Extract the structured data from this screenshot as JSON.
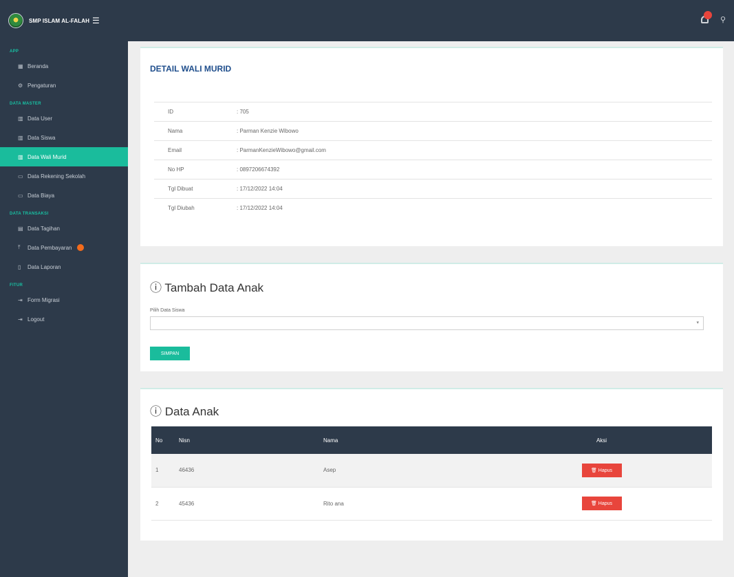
{
  "header": {
    "app_title": "SMP ISLAM AL-FALAH",
    "menu_toggle": "☰"
  },
  "sidebar": {
    "sections": [
      {
        "label": "APP",
        "items": [
          {
            "label": "Beranda",
            "icon": "grid-icon",
            "glyph": "▦"
          },
          {
            "label": "Pengaturan",
            "icon": "gear-icon",
            "glyph": "⚙"
          }
        ]
      },
      {
        "label": "DATA MASTER",
        "items": [
          {
            "label": "Data User",
            "icon": "users-icon",
            "glyph": "▥"
          },
          {
            "label": "Data Siswa",
            "icon": "users-icon",
            "glyph": "▥"
          },
          {
            "label": "Data Wali Murid",
            "icon": "users-icon",
            "glyph": "▥",
            "active": true
          },
          {
            "label": "Data Rekening Sekolah",
            "icon": "card-icon",
            "glyph": "▭"
          },
          {
            "label": "Data Biaya",
            "icon": "card-icon",
            "glyph": "▭"
          }
        ]
      },
      {
        "label": "DATA TRANSAKSI",
        "items": [
          {
            "label": "Data Tagihan",
            "icon": "calendar-icon",
            "glyph": "▤"
          },
          {
            "label": "Data Pembayaran",
            "icon": "upload-icon",
            "glyph": "⤒",
            "badge": true
          },
          {
            "label": "Data Laporan",
            "icon": "document-icon",
            "glyph": "▯"
          }
        ]
      },
      {
        "label": "FITUR",
        "items": [
          {
            "label": "Form Migrasi",
            "icon": "sign-in-icon",
            "glyph": "⇥"
          },
          {
            "label": "Logout",
            "icon": "sign-out-icon",
            "glyph": "⇥"
          }
        ]
      }
    ]
  },
  "detail": {
    "title": "DETAIL WALI MURID",
    "rows": [
      {
        "key": "ID",
        "value": ": 705"
      },
      {
        "key": "Nama",
        "value": ": Parman Kenzie Wibowo"
      },
      {
        "key": "Email",
        "value": ": ParmanKenzieWibowo@gmail.com"
      },
      {
        "key": "No HP",
        "value": ": 0897206674392"
      },
      {
        "key": "Tgl Dibuat",
        "value": ": 17/12/2022 14:04"
      },
      {
        "key": "Tgl Diubah",
        "value": ": 17/12/2022 14:04"
      }
    ]
  },
  "add_child": {
    "title": "ⓘ Tambah Data Anak",
    "select_label": "Pilih Data Siswa",
    "select_value": "",
    "save_label": "SIMPAN"
  },
  "children": {
    "title": "ⓘ Data Anak",
    "columns": [
      "No",
      "Nisn",
      "Nama",
      "Aksi"
    ],
    "rows": [
      {
        "no": "1",
        "nisn": "46436",
        "nama": "Asep",
        "action": "🗑 Hapus"
      },
      {
        "no": "2",
        "nisn": "45436",
        "nama": "Rito ana",
        "action": "🗑 Hapus"
      }
    ]
  },
  "colors": {
    "sidebar_bg": "#2d3a4a",
    "accent": "#1abc9c",
    "danger": "#e8453c",
    "title_blue": "#1f4e8c"
  }
}
